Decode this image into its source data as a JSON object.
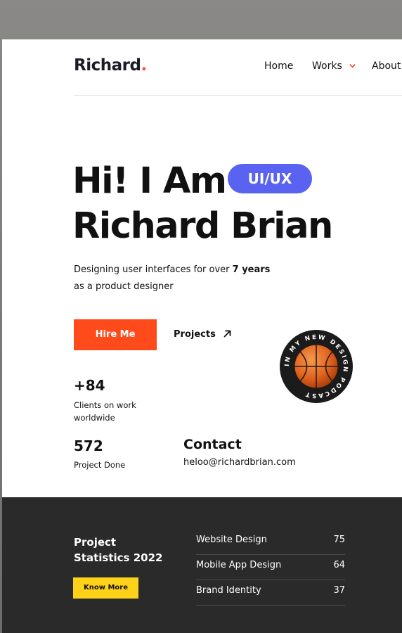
{
  "header": {
    "logo_text": "Richard",
    "logo_dot": ".",
    "nav": [
      {
        "label": "Home"
      },
      {
        "label": "Works",
        "has_dropdown": true
      },
      {
        "label": "About"
      }
    ]
  },
  "hero": {
    "title_line1": "Hi! I Am",
    "title_line2": "Richard Brian",
    "badge": "UI/UX",
    "tagline_pre": "Designing user interfaces for over ",
    "tagline_bold": "7 years",
    "tagline_post": "as a product designer",
    "hire_button": "Hire Me",
    "projects_link": "Projects",
    "podcast_badge_text": "IN MY NEW DESIGN PODCAST"
  },
  "stats": {
    "clients_value": "+84",
    "clients_label": "Clients on work worldwide",
    "projects_value": "572",
    "projects_label": "Project Done"
  },
  "contact": {
    "heading": "Contact",
    "email": "heloo@richardbrian.com"
  },
  "statistics": {
    "heading_line1": "Project",
    "heading_line2": "Statistics 2022",
    "button": "Know More",
    "rows": [
      {
        "name": "Website Design",
        "value": "75"
      },
      {
        "name": "Mobile App Design",
        "value": "64"
      },
      {
        "name": "Brand Identity",
        "value": "37"
      }
    ]
  },
  "colors": {
    "accent": "#ff4a1c",
    "badge": "#5a62f2",
    "cta_yellow": "#ffd21a",
    "dark_section": "#2a2a2a"
  }
}
